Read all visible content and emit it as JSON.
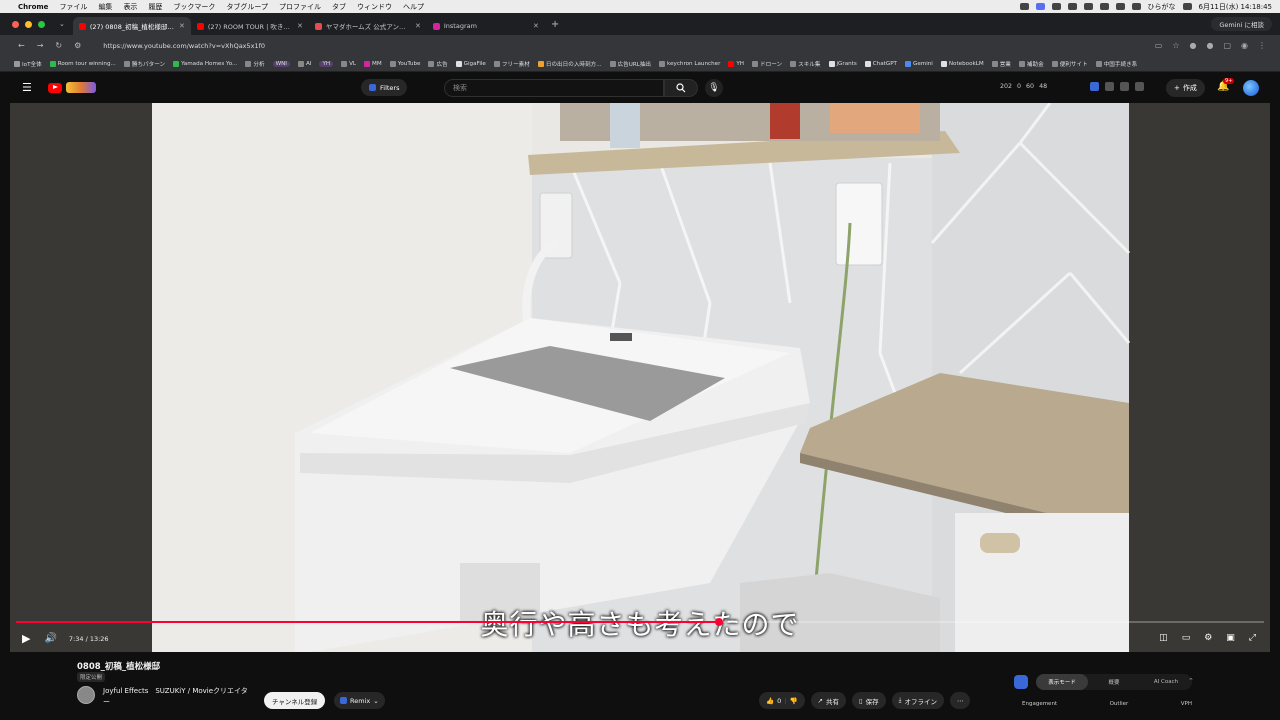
{
  "macos_menu": {
    "app": "Chrome",
    "items": [
      "ファイル",
      "編集",
      "表示",
      "履歴",
      "ブックマーク",
      "タブグループ",
      "プロファイル",
      "タブ",
      "ウィンドウ",
      "ヘルプ"
    ],
    "input_method": "ひらがな",
    "clock": "6月11日(水) 14:18:45"
  },
  "browser": {
    "tabs": [
      {
        "title": "(27) 0808_初稿_植松様邸 - YouTube",
        "favicon_color": "#ff0000",
        "active": true
      },
      {
        "title": "(27) ROOM TOUR | 吹き抜け",
        "favicon_color": "#ff0000",
        "active": false
      },
      {
        "title": "ヤマダホームズ 公式アンバサダー",
        "favicon_color": "#e34d4d",
        "active": false
      },
      {
        "title": "Instagram",
        "favicon_color": "#d6249f",
        "active": false
      }
    ],
    "gemini_button": "Gemini に相談",
    "url": "https://www.youtube.com/watch?v=vXhQax5x1f0",
    "bookmarks": [
      {
        "label": "IoT全体",
        "color": "#999"
      },
      {
        "label": "Room tour winning...",
        "color": "#2dbb4e"
      },
      {
        "label": "勝ちパターン",
        "color": "#888"
      },
      {
        "label": "Yamada Homes Yo...",
        "color": "#2dbb4e"
      },
      {
        "label": "分析",
        "color": "#888"
      },
      {
        "label": "WNI",
        "color": "#6a4f9a",
        "pill": true
      },
      {
        "label": "AI",
        "color": "#888"
      },
      {
        "label": "YH",
        "color": "#6a4f9a",
        "pill": true
      },
      {
        "label": "VL",
        "color": "#888"
      },
      {
        "label": "MM",
        "color": "#d6249f"
      },
      {
        "label": "YouTube",
        "color": "#888"
      },
      {
        "label": "広告",
        "color": "#888"
      },
      {
        "label": "GigaFile",
        "color": "#e0e0e0"
      },
      {
        "label": "フリー素材",
        "color": "#888"
      },
      {
        "label": "日の出日の入時刻方...",
        "color": "#f0a030"
      },
      {
        "label": "広告URL抽出",
        "color": "#888"
      },
      {
        "label": "keychron Launcher",
        "color": "#888"
      },
      {
        "label": "YH",
        "color": "#ff0000"
      },
      {
        "label": "ドローン",
        "color": "#888"
      },
      {
        "label": "スキル集",
        "color": "#888"
      },
      {
        "label": "jGrants",
        "color": "#e0e0e0"
      },
      {
        "label": "ChatGPT",
        "color": "#e0e0e0"
      },
      {
        "label": "Gemini",
        "color": "#4d8af0"
      },
      {
        "label": "NotebookLM",
        "color": "#e0e0e0"
      },
      {
        "label": "営業",
        "color": "#888"
      },
      {
        "label": "補助金",
        "color": "#888"
      },
      {
        "label": "便利サイト",
        "color": "#888"
      },
      {
        "label": "中国手続き系",
        "color": "#888"
      }
    ]
  },
  "youtube": {
    "filters_label": "Filters",
    "search_placeholder": "検索",
    "stats": [
      "202",
      "0",
      "60",
      "48"
    ],
    "create_label": "作成",
    "notif_badge": "9+",
    "player": {
      "current_time": "7:34",
      "duration": "13:26",
      "time_display": "7:34 / 13:26",
      "progress": 0.5633,
      "subtitle": "奥行や高さも考えたので"
    },
    "video": {
      "title": "0808_初稿_植松様邸",
      "visibility": "限定公開",
      "channel": "Joyful Effects　SUZUKiY / Movieクリエイター",
      "subscribe_label": "チャンネル登録",
      "remix_label": "Remix",
      "like_count": "0",
      "share_label": "共有",
      "save_label": "保存",
      "offline_label": "オフライン"
    },
    "extension_panel": {
      "tabs": [
        "表示モード",
        "概要",
        "AI Coach"
      ],
      "columns": [
        "Engagement",
        "Outlier",
        "VPH"
      ]
    }
  }
}
